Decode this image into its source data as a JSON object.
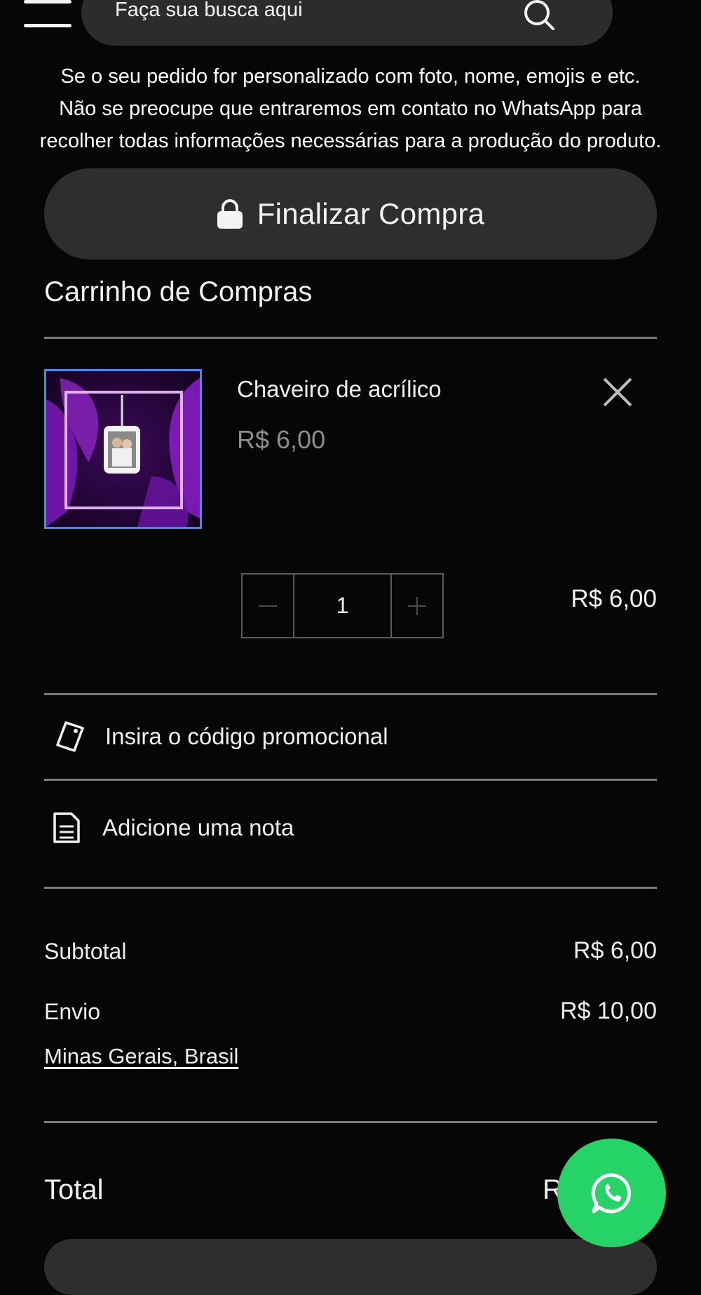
{
  "header": {
    "search_placeholder": "Faça sua busca aqui"
  },
  "notice": "Se o seu pedido for personalizado com foto, nome, emojis e etc. Não se preocupe que entraremos em contato no WhatsApp para recolher todas informações necessárias para a produção do produto.",
  "checkout_button": {
    "label": "Finalizar Compra",
    "icon": "lock-icon"
  },
  "cart": {
    "title": "Carrinho de Compras",
    "items": [
      {
        "name": "Chaveiro de acrílico",
        "price": "R$ 6,00",
        "quantity": "1",
        "line_total": "R$ 6,00"
      }
    ]
  },
  "promo": {
    "label": "Insira o código promocional",
    "icon": "tag-icon"
  },
  "note": {
    "label": "Adicione uma nota",
    "icon": "note-icon"
  },
  "summary": {
    "subtotal_label": "Subtotal",
    "subtotal_value": "R$ 6,00",
    "shipping_label": "Envio",
    "shipping_value": "R$ 10,00",
    "location": "Minas Gerais, Brasil",
    "total_label": "Total",
    "total_value_visible": "R"
  },
  "colors": {
    "background": "#060606",
    "button_bg": "#2e2e2e",
    "whatsapp": "#25d366",
    "thumb_border": "#3d8cf5"
  }
}
